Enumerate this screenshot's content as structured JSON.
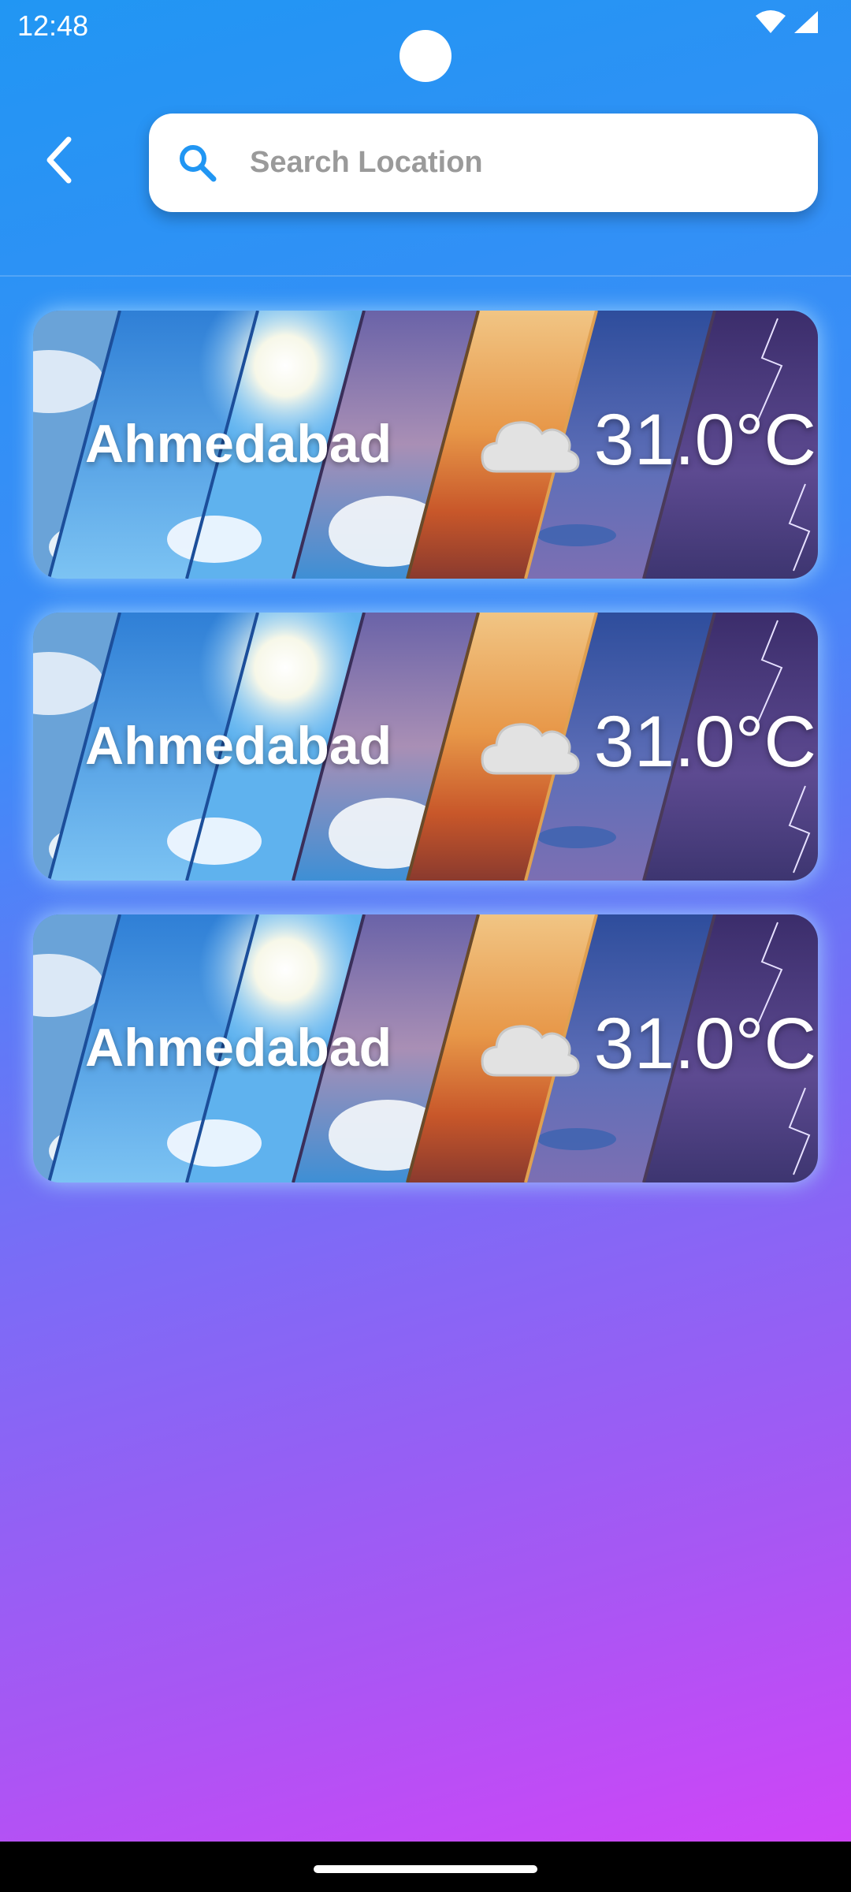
{
  "status_bar": {
    "time": "12:48",
    "icons": [
      "wifi-icon",
      "cellular-signal-icon"
    ]
  },
  "header": {
    "back_icon": "chevron-left-icon",
    "search": {
      "icon": "search-icon",
      "placeholder": "Search Location",
      "value": ""
    }
  },
  "locations": [
    {
      "city": "Ahmedabad",
      "condition_icon": "cloud-icon",
      "temperature": "31.0°C"
    },
    {
      "city": "Ahmedabad",
      "condition_icon": "cloud-icon",
      "temperature": "31.0°C"
    },
    {
      "city": "Ahmedabad",
      "condition_icon": "cloud-icon",
      "temperature": "31.0°C"
    }
  ],
  "colors": {
    "gradient_top": "#2196f3",
    "gradient_bottom": "#d542f8",
    "search_icon": "#2196f3",
    "placeholder": "#9a9a9a"
  }
}
